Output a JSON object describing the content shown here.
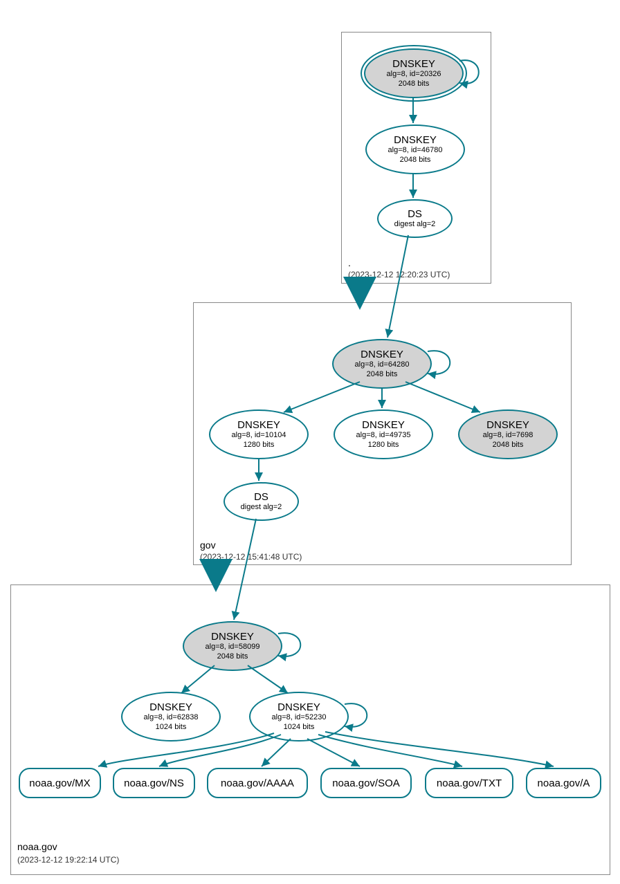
{
  "zones": {
    "root": {
      "label": ".",
      "timestamp": "(2023-12-12 12:20:23 UTC)"
    },
    "gov": {
      "label": "gov",
      "timestamp": "(2023-12-12 15:41:48 UTC)"
    },
    "noaa": {
      "label": "noaa.gov",
      "timestamp": "(2023-12-12 19:22:14 UTC)"
    }
  },
  "nodes": {
    "root_ksk": {
      "title": "DNSKEY",
      "line1": "alg=8, id=20326",
      "line2": "2048 bits"
    },
    "root_zsk": {
      "title": "DNSKEY",
      "line1": "alg=8, id=46780",
      "line2": "2048 bits"
    },
    "root_ds": {
      "title": "DS",
      "line1": "digest alg=2"
    },
    "gov_ksk": {
      "title": "DNSKEY",
      "line1": "alg=8, id=64280",
      "line2": "2048 bits"
    },
    "gov_zsk1": {
      "title": "DNSKEY",
      "line1": "alg=8, id=10104",
      "line2": "1280 bits"
    },
    "gov_zsk2": {
      "title": "DNSKEY",
      "line1": "alg=8, id=49735",
      "line2": "1280 bits"
    },
    "gov_ksk2": {
      "title": "DNSKEY",
      "line1": "alg=8, id=7698",
      "line2": "2048 bits"
    },
    "gov_ds": {
      "title": "DS",
      "line1": "digest alg=2"
    },
    "noaa_ksk": {
      "title": "DNSKEY",
      "line1": "alg=8, id=58099",
      "line2": "2048 bits"
    },
    "noaa_zsk1": {
      "title": "DNSKEY",
      "line1": "alg=8, id=62838",
      "line2": "1024 bits"
    },
    "noaa_zsk2": {
      "title": "DNSKEY",
      "line1": "alg=8, id=52230",
      "line2": "1024 bits"
    },
    "rr_mx": {
      "title": "noaa.gov/MX"
    },
    "rr_ns": {
      "title": "noaa.gov/NS"
    },
    "rr_aaaa": {
      "title": "noaa.gov/AAAA"
    },
    "rr_soa": {
      "title": "noaa.gov/SOA"
    },
    "rr_txt": {
      "title": "noaa.gov/TXT"
    },
    "rr_a": {
      "title": "noaa.gov/A"
    }
  }
}
